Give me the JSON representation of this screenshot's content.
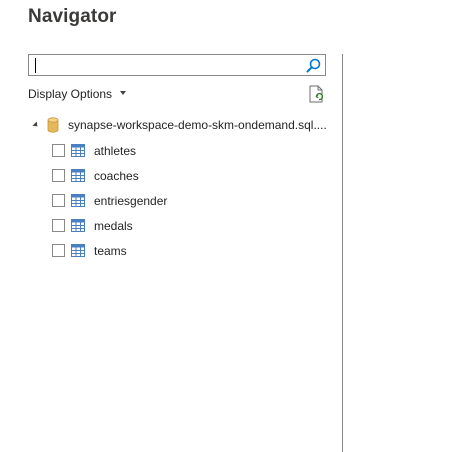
{
  "window": {
    "title": "Navigator"
  },
  "search": {
    "value": "",
    "placeholder": "",
    "icon": "search-icon"
  },
  "display_options": {
    "label": "Display Options",
    "icon": "chevron-down-icon"
  },
  "toolbar": {
    "refresh_icon": "refresh-icon"
  },
  "tree": {
    "root": {
      "label": "synapse-workspace-demo-skm-ondemand.sql....",
      "icon": "database-icon",
      "expanded": true
    },
    "items": [
      {
        "label": "athletes",
        "checked": false,
        "icon": "table-icon"
      },
      {
        "label": "coaches",
        "checked": false,
        "icon": "table-icon"
      },
      {
        "label": "entriesgender",
        "checked": false,
        "icon": "table-icon"
      },
      {
        "label": "medals",
        "checked": false,
        "icon": "table-icon"
      },
      {
        "label": "teams",
        "checked": false,
        "icon": "table-icon"
      }
    ]
  },
  "colors": {
    "border": "#8a8886",
    "text": "#252423",
    "search_icon": "#0078d4",
    "table_icon": "#4a7fc1",
    "database_icon": "#e6b85c",
    "refresh_accent": "#2d7d2d"
  }
}
